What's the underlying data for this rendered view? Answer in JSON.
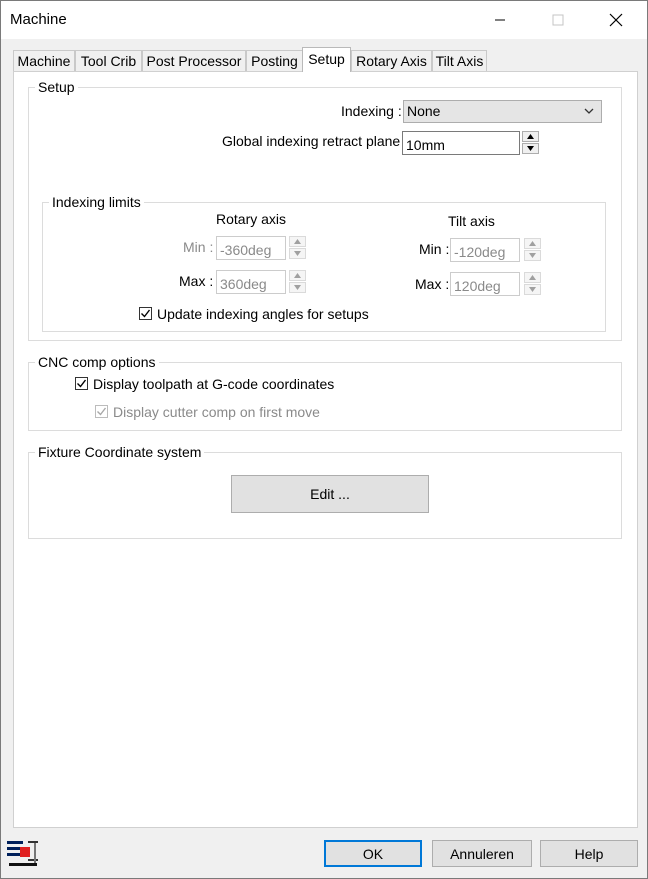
{
  "window": {
    "title": "Machine"
  },
  "tabs": [
    {
      "label": "Machine"
    },
    {
      "label": "Tool Crib"
    },
    {
      "label": "Post Processor"
    },
    {
      "label": "Posting"
    },
    {
      "label": "Setup"
    },
    {
      "label": "Rotary Axis"
    },
    {
      "label": "Tilt Axis"
    }
  ],
  "active_tab": "Setup",
  "setup": {
    "group_label": "Setup",
    "indexing_label": "Indexing :",
    "indexing_value": "None",
    "retract_label": "Global indexing retract plane :",
    "retract_value": "10mm",
    "limits": {
      "group_label": "Indexing limits",
      "rotary_header": "Rotary axis",
      "tilt_header": "Tilt axis",
      "min_label": "Min :",
      "max_label": "Max :",
      "rotary_min": "-360deg",
      "rotary_max": "360deg",
      "tilt_min": "-120deg",
      "tilt_max": "120deg",
      "update_label": "Update indexing angles for setups",
      "update_checked": true
    }
  },
  "cnc": {
    "group_label": "CNC comp options",
    "display_toolpath_label": "Display toolpath at G-code coordinates",
    "display_toolpath_checked": true,
    "display_cutter_label": "Display cutter comp on first move",
    "display_cutter_checked": true
  },
  "fixture": {
    "group_label": "Fixture Coordinate system",
    "edit_label": "Edit ..."
  },
  "footer": {
    "ok_label": "OK",
    "cancel_label": "Annuleren",
    "help_label": "Help"
  },
  "icons": {
    "app": "machine-app-icon",
    "minimize": "minimize-icon",
    "maximize": "maximize-icon",
    "close": "close-icon",
    "dropdown": "chevron-down-icon",
    "spin_up": "arrow-up-icon",
    "spin_down": "arrow-down-icon",
    "check": "checkmark-icon"
  },
  "colors": {
    "accent": "#0078d7",
    "disabled_text": "#8a8a8a"
  }
}
